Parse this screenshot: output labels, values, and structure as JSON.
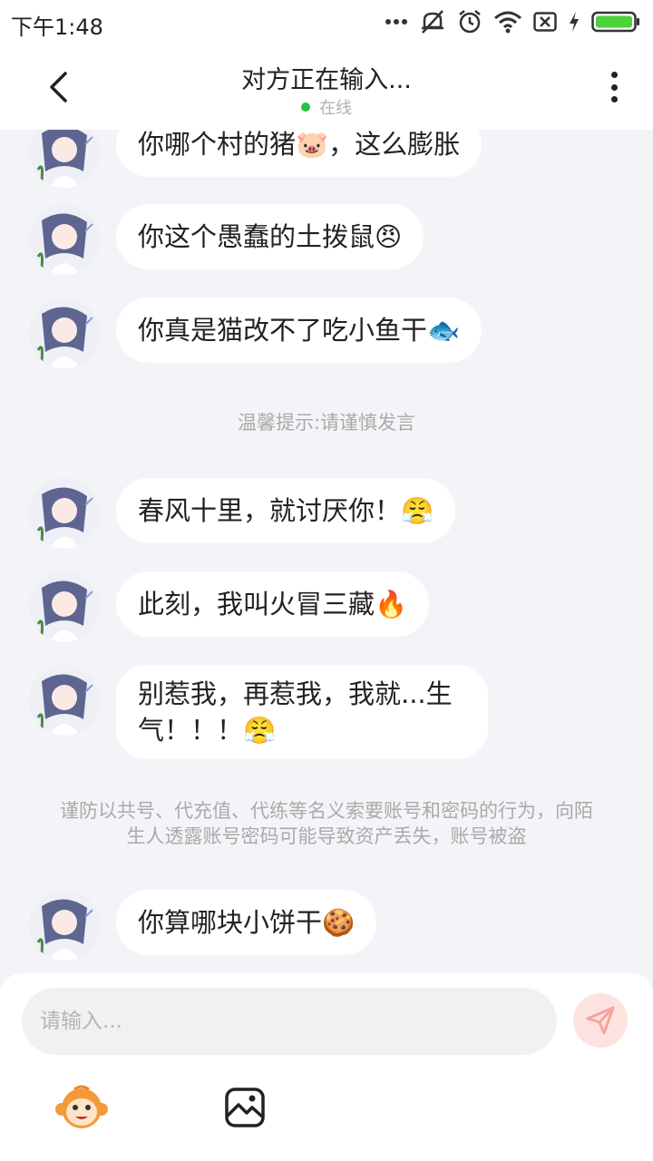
{
  "status_bar": {
    "time": "下午1:48"
  },
  "header": {
    "title": "对方正在输入...",
    "status": "在线"
  },
  "messages": [
    {
      "text": "你哪个村的猪🐷，这么膨胀"
    },
    {
      "text": "你这个愚蠢的土拨鼠😠"
    },
    {
      "text": "你真是猫改不了吃小鱼干🐟"
    },
    {
      "text": "春风十里，就讨厌你！😤"
    },
    {
      "text": "此刻，我叫火冒三藏🔥"
    },
    {
      "text": "别惹我，再惹我，我就...生气！！！😤"
    },
    {
      "text": "你算哪块小饼干🍪"
    }
  ],
  "tips": {
    "caution": "温馨提示:请谨慎发言",
    "security": "谨防以共号、代充值、代练等名义索要账号和密码的行为，向陌生人透露账号密码可能导致资产丢失，账号被盗"
  },
  "composer": {
    "placeholder": "请输入..."
  },
  "icons": {
    "back": "chevron-left-icon",
    "more": "more-vertical-icon",
    "send": "send-icon",
    "emoji": "monkey-emoji-icon",
    "image": "image-icon"
  },
  "colors": {
    "online": "#22c34a",
    "send_bg": "#fde3e0",
    "send_icon": "#f7a49b",
    "monkey": "#f29a3a"
  }
}
